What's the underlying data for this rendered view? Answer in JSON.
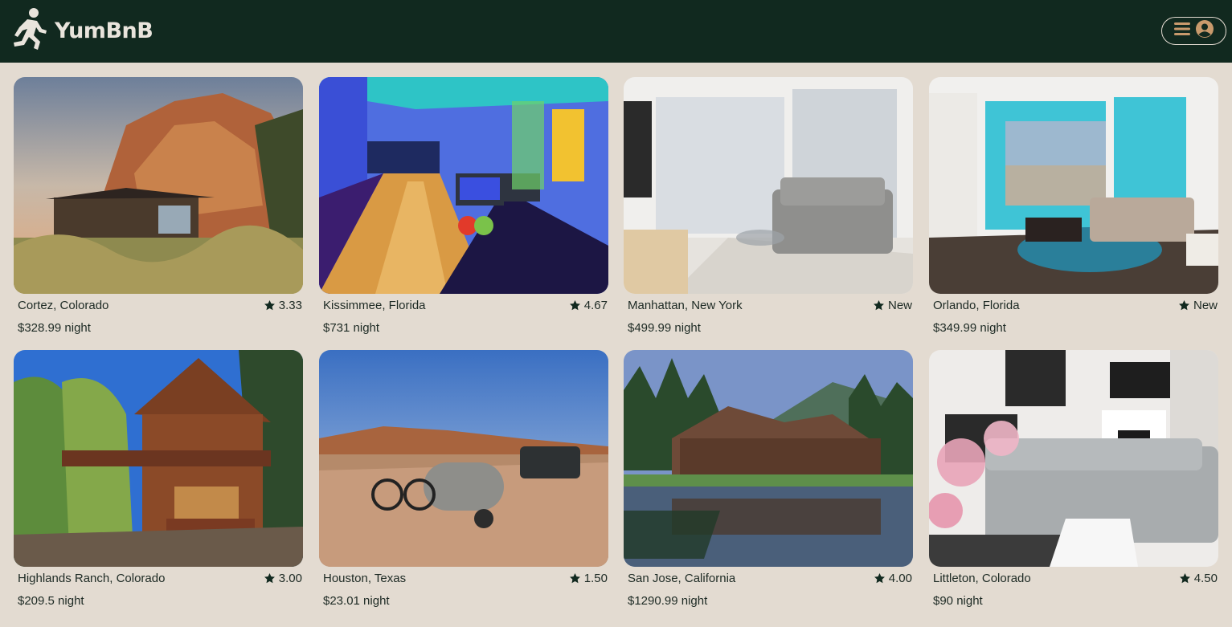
{
  "brand": {
    "name": "YumBnB",
    "logo_icon": "running-person-icon"
  },
  "menu": {
    "menu_icon": "hamburger-icon",
    "profile_icon": "user-circle-icon"
  },
  "colors": {
    "nav": "#11291f",
    "accent": "#c89a6c",
    "background": "#e3dbd1"
  },
  "listings": [
    {
      "location": "Cortez, Colorado",
      "rating": "3.33",
      "price": "$328.99 night"
    },
    {
      "location": "Kissimmee, Florida",
      "rating": "4.67",
      "price": "$731 night"
    },
    {
      "location": "Manhattan, New York",
      "rating": "New",
      "price": "$499.99 night"
    },
    {
      "location": "Orlando, Florida",
      "rating": "New",
      "price": "$349.99 night"
    },
    {
      "location": "Highlands Ranch, Colorado",
      "rating": "3.00",
      "price": "$209.5 night"
    },
    {
      "location": "Houston, Texas",
      "rating": "1.50",
      "price": "$23.01 night"
    },
    {
      "location": "San Jose, California",
      "rating": "4.00",
      "price": "$1290.99 night"
    },
    {
      "location": "Littleton, Colorado",
      "rating": "4.50",
      "price": "$90 night"
    }
  ]
}
